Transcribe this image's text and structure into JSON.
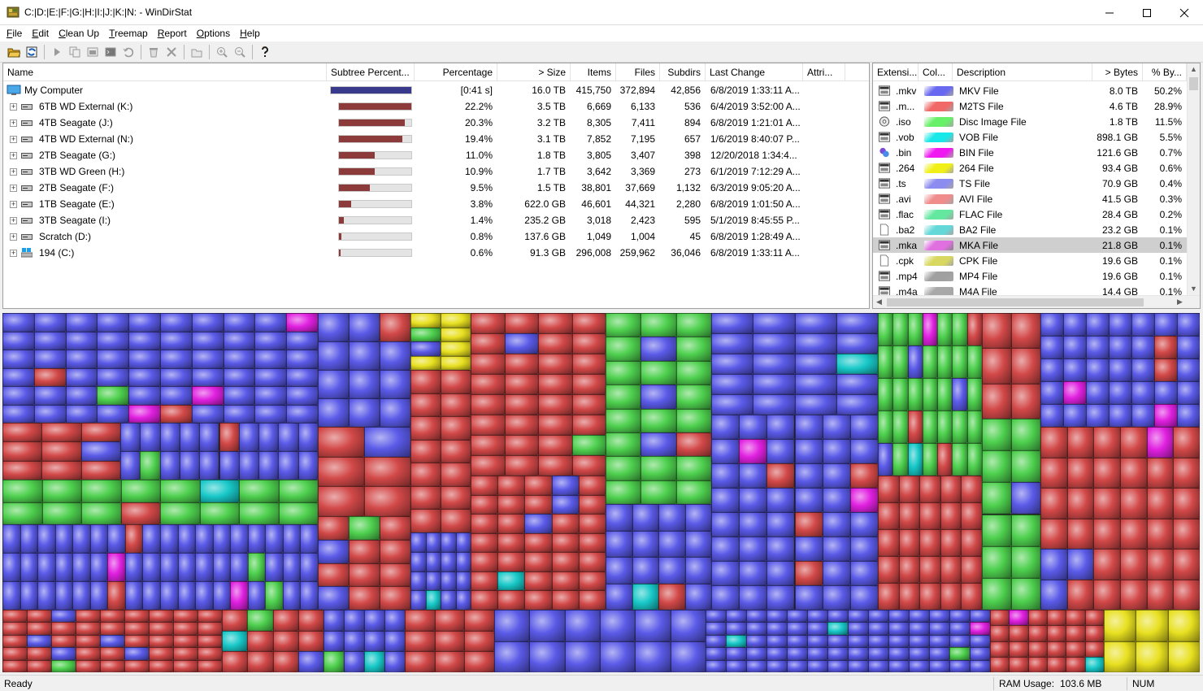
{
  "window": {
    "title": "C:|D:|E:|F:|G:|H:|I:|J:|K:|N: - WinDirStat"
  },
  "menu": [
    {
      "label": "File",
      "mnemonic": "F",
      "rest": "ile"
    },
    {
      "label": "Edit",
      "mnemonic": "E",
      "rest": "dit"
    },
    {
      "label": "Clean Up",
      "mnemonic": "C",
      "rest": "lean Up"
    },
    {
      "label": "Treemap",
      "mnemonic": "T",
      "rest": "reemap"
    },
    {
      "label": "Report",
      "mnemonic": "R",
      "rest": "eport"
    },
    {
      "label": "Options",
      "mnemonic": "O",
      "rest": "ptions"
    },
    {
      "label": "Help",
      "mnemonic": "H",
      "rest": "elp"
    }
  ],
  "toolbar": [
    {
      "name": "open-icon",
      "color": "#d9a520"
    },
    {
      "name": "refresh-icon",
      "color": "#1a5fb4"
    },
    {
      "sep": true
    },
    {
      "name": "play-icon",
      "color": "#9a9a9a"
    },
    {
      "name": "copy-path-icon",
      "color": "#9a9a9a"
    },
    {
      "name": "explorer-icon",
      "color": "#9a9a9a"
    },
    {
      "name": "command-prompt-icon",
      "color": "#9a9a9a"
    },
    {
      "name": "refresh-selected-icon",
      "color": "#9a9a9a"
    },
    {
      "sep": true
    },
    {
      "name": "recycle-bin-icon",
      "color": "#9a9a9a"
    },
    {
      "name": "delete-icon",
      "color": "#9a9a9a"
    },
    {
      "sep": true
    },
    {
      "name": "properties-icon",
      "color": "#9a9a9a"
    },
    {
      "sep": true
    },
    {
      "name": "zoom-in-icon",
      "color": "#9a9a9a"
    },
    {
      "name": "zoom-out-icon",
      "color": "#9a9a9a"
    },
    {
      "sep": true
    },
    {
      "name": "help-icon",
      "color": "#1a1a1a"
    }
  ],
  "dir_columns": {
    "name": "Name",
    "subtree": "Subtree Percent...",
    "percentage": "Percentage",
    "size": "> Size",
    "items": "Items",
    "files": "Files",
    "subdirs": "Subdirs",
    "last_change": "Last Change",
    "attributes": "Attri..."
  },
  "dir_root": {
    "name": "My Computer",
    "subtree_fraction": 1.0,
    "percentage": "[0:41 s]",
    "size": "16.0 TB",
    "items": "415,750",
    "files": "372,894",
    "subdirs": "42,856",
    "last_change": "6/8/2019 1:33:11 A..."
  },
  "dir_rows": [
    {
      "name": "6TB WD External (K:)",
      "subtree_fraction": 0.222,
      "percentage": "22.2%",
      "size": "3.5 TB",
      "items": "6,669",
      "files": "6,133",
      "subdirs": "536",
      "last_change": "6/4/2019 3:52:00 A..."
    },
    {
      "name": "4TB Seagate (J:)",
      "subtree_fraction": 0.203,
      "percentage": "20.3%",
      "size": "3.2 TB",
      "items": "8,305",
      "files": "7,411",
      "subdirs": "894",
      "last_change": "6/8/2019 1:21:01 A..."
    },
    {
      "name": "4TB WD External (N:)",
      "subtree_fraction": 0.194,
      "percentage": "19.4%",
      "size": "3.1 TB",
      "items": "7,852",
      "files": "7,195",
      "subdirs": "657",
      "last_change": "1/6/2019 8:40:07 P..."
    },
    {
      "name": "2TB Seagate (G:)",
      "subtree_fraction": 0.11,
      "percentage": "11.0%",
      "size": "1.8 TB",
      "items": "3,805",
      "files": "3,407",
      "subdirs": "398",
      "last_change": "12/20/2018 1:34:4..."
    },
    {
      "name": "3TB WD Green (H:)",
      "subtree_fraction": 0.109,
      "percentage": "10.9%",
      "size": "1.7 TB",
      "items": "3,642",
      "files": "3,369",
      "subdirs": "273",
      "last_change": "6/1/2019 7:12:29 A..."
    },
    {
      "name": "2TB Seagate (F:)",
      "subtree_fraction": 0.095,
      "percentage": "9.5%",
      "size": "1.5 TB",
      "items": "38,801",
      "files": "37,669",
      "subdirs": "1,132",
      "last_change": "6/3/2019 9:05:20 A..."
    },
    {
      "name": "1TB Seagate (E:)",
      "subtree_fraction": 0.038,
      "percentage": "3.8%",
      "size": "622.0 GB",
      "items": "46,601",
      "files": "44,321",
      "subdirs": "2,280",
      "last_change": "6/8/2019 1:01:50 A..."
    },
    {
      "name": "3TB Seagate (I:)",
      "subtree_fraction": 0.014,
      "percentage": "1.4%",
      "size": "235.2 GB",
      "items": "3,018",
      "files": "2,423",
      "subdirs": "595",
      "last_change": "5/1/2019 8:45:55 P..."
    },
    {
      "name": "Scratch (D:)",
      "subtree_fraction": 0.008,
      "percentage": "0.8%",
      "size": "137.6 GB",
      "items": "1,049",
      "files": "1,004",
      "subdirs": "45",
      "last_change": "6/8/2019 1:28:49 A..."
    },
    {
      "name": "194 (C:)",
      "subtree_fraction": 0.006,
      "percentage": "0.6%",
      "size": "91.3 GB",
      "items": "296,008",
      "files": "259,962",
      "subdirs": "36,046",
      "last_change": "6/8/2019 1:33:11 A...",
      "system": true
    }
  ],
  "ext_columns": {
    "extension": "Extensi...",
    "color": "Col...",
    "description": "Description",
    "bytes": "> Bytes",
    "percent_bytes": "% By..."
  },
  "ext_rows": [
    {
      "ext": ".mkv",
      "color": "#6868f0",
      "desc": "MKV File",
      "bytes": "8.0 TB",
      "pct": "50.2%",
      "icon": "video"
    },
    {
      "ext": ".m...",
      "color": "#f06868",
      "desc": "M2TS File",
      "bytes": "4.6 TB",
      "pct": "28.9%",
      "icon": "video"
    },
    {
      "ext": ".iso",
      "color": "#68f068",
      "desc": "Disc Image File",
      "bytes": "1.8 TB",
      "pct": "11.5%",
      "icon": "disc"
    },
    {
      "ext": ".vob",
      "color": "#18e8e8",
      "desc": "VOB File",
      "bytes": "898.1 GB",
      "pct": "5.5%",
      "icon": "video"
    },
    {
      "ext": ".bin",
      "color": "#f018f0",
      "desc": "BIN File",
      "bytes": "121.6 GB",
      "pct": "0.7%",
      "icon": "bin"
    },
    {
      "ext": ".264",
      "color": "#f0f018",
      "desc": "264 File",
      "bytes": "93.4 GB",
      "pct": "0.6%",
      "icon": "video"
    },
    {
      "ext": ".ts",
      "color": "#8c8cf0",
      "desc": "TS File",
      "bytes": "70.9 GB",
      "pct": "0.4%",
      "icon": "video"
    },
    {
      "ext": ".avi",
      "color": "#f08c8c",
      "desc": "AVI File",
      "bytes": "41.5 GB",
      "pct": "0.3%",
      "icon": "video"
    },
    {
      "ext": ".flac",
      "color": "#64e8a0",
      "desc": "FLAC File",
      "bytes": "28.4 GB",
      "pct": "0.2%",
      "icon": "video"
    },
    {
      "ext": ".ba2",
      "color": "#64d8d8",
      "desc": "BA2 File",
      "bytes": "23.2 GB",
      "pct": "0.1%",
      "icon": "blank"
    },
    {
      "ext": ".mka",
      "color": "#e070e0",
      "desc": "MKA File",
      "bytes": "21.8 GB",
      "pct": "0.1%",
      "icon": "video",
      "selected": true
    },
    {
      "ext": ".cpk",
      "color": "#d8d860",
      "desc": "CPK File",
      "bytes": "19.6 GB",
      "pct": "0.1%",
      "icon": "blank"
    },
    {
      "ext": ".mp4",
      "color": "#a0a0a0",
      "desc": "MP4 File",
      "bytes": "19.6 GB",
      "pct": "0.1%",
      "icon": "video"
    },
    {
      "ext": ".m4a",
      "color": "#a8a8a8",
      "desc": "M4A File",
      "bytes": "14.4 GB",
      "pct": "0.1%",
      "icon": "video"
    }
  ],
  "status": {
    "ready": "Ready",
    "ram_label": "RAM Usage:",
    "ram_value": "103.6 MB",
    "num": "NUM"
  },
  "colors": {
    "blue": "#5a5ae8",
    "red": "#d24848",
    "green": "#4ed04e",
    "cyan": "#18c8c8",
    "magenta": "#e020e0",
    "yellow": "#e8e020",
    "gray": "#9a9a9a",
    "root_bar": "#3a3a8c",
    "drive_bar": "#8c3a3a"
  }
}
